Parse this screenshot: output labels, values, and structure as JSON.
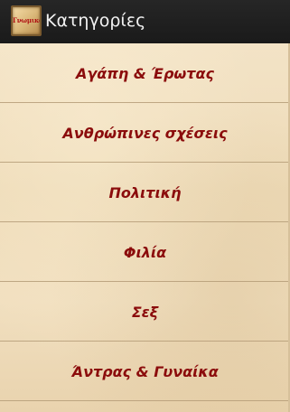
{
  "app": {
    "title": "Κατηγορίες",
    "logo_text": "Γνωμικά",
    "icon": "app-logo-icon"
  },
  "categories": [
    {
      "label": "Αγάπη & Έρωτας"
    },
    {
      "label": "Ανθρώπινες σχέσεις"
    },
    {
      "label": "Πολιτική"
    },
    {
      "label": "Φιλία"
    },
    {
      "label": "Σεξ"
    },
    {
      "label": "Άντρας & Γυναίκα"
    }
  ],
  "colors": {
    "actionbar": "#1f1f1f",
    "title_text": "#f2f2f2",
    "item_text": "#8b0c0c",
    "background": "#f0dfbf",
    "divider": "#b59c78"
  }
}
